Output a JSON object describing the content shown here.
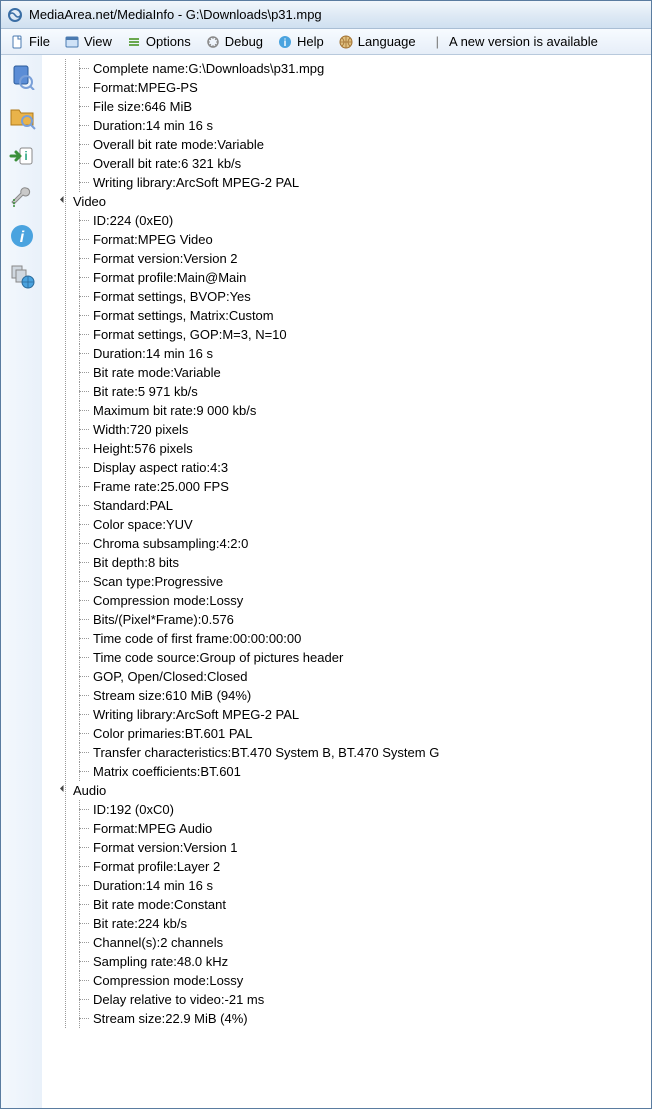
{
  "window": {
    "title": "MediaArea.net/MediaInfo - G:\\Downloads\\p31.mpg"
  },
  "menu": {
    "file": "File",
    "view": "View",
    "options": "Options",
    "debug": "Debug",
    "help": "Help",
    "language": "Language",
    "version_notice": "A new version is available"
  },
  "general": {
    "items": [
      {
        "label": "Complete name",
        "value": "G:\\Downloads\\p31.mpg"
      },
      {
        "label": "Format",
        "value": "MPEG-PS"
      },
      {
        "label": "File size",
        "value": "646 MiB"
      },
      {
        "label": "Duration",
        "value": "14 min 16 s"
      },
      {
        "label": "Overall bit rate mode",
        "value": "Variable"
      },
      {
        "label": "Overall bit rate",
        "value": "6 321 kb/s"
      },
      {
        "label": "Writing library",
        "value": "ArcSoft MPEG-2 PAL"
      }
    ]
  },
  "video": {
    "title": "Video",
    "items": [
      {
        "label": "ID",
        "value": "224 (0xE0)"
      },
      {
        "label": "Format",
        "value": "MPEG Video"
      },
      {
        "label": "Format version",
        "value": "Version 2"
      },
      {
        "label": "Format profile",
        "value": "Main@Main"
      },
      {
        "label": "Format settings, BVOP",
        "value": "Yes"
      },
      {
        "label": "Format settings, Matrix",
        "value": "Custom"
      },
      {
        "label": "Format settings, GOP",
        "value": "M=3, N=10"
      },
      {
        "label": "Duration",
        "value": "14 min 16 s"
      },
      {
        "label": "Bit rate mode",
        "value": "Variable"
      },
      {
        "label": "Bit rate",
        "value": "5 971 kb/s"
      },
      {
        "label": "Maximum bit rate",
        "value": "9 000 kb/s"
      },
      {
        "label": "Width",
        "value": "720 pixels"
      },
      {
        "label": "Height",
        "value": "576 pixels"
      },
      {
        "label": "Display aspect ratio",
        "value": "4:3"
      },
      {
        "label": "Frame rate",
        "value": "25.000 FPS"
      },
      {
        "label": "Standard",
        "value": "PAL"
      },
      {
        "label": "Color space",
        "value": "YUV"
      },
      {
        "label": "Chroma subsampling",
        "value": "4:2:0"
      },
      {
        "label": "Bit depth",
        "value": "8 bits"
      },
      {
        "label": "Scan type",
        "value": "Progressive"
      },
      {
        "label": "Compression mode",
        "value": "Lossy"
      },
      {
        "label": "Bits/(Pixel*Frame)",
        "value": "0.576"
      },
      {
        "label": "Time code of first frame",
        "value": "00:00:00:00"
      },
      {
        "label": "Time code source",
        "value": "Group of pictures header"
      },
      {
        "label": "GOP, Open/Closed",
        "value": "Closed"
      },
      {
        "label": "Stream size",
        "value": "610 MiB (94%)"
      },
      {
        "label": "Writing library",
        "value": "ArcSoft MPEG-2 PAL"
      },
      {
        "label": "Color primaries",
        "value": "BT.601 PAL"
      },
      {
        "label": "Transfer characteristics",
        "value": "BT.470 System B, BT.470 System G"
      },
      {
        "label": "Matrix coefficients",
        "value": "BT.601"
      }
    ]
  },
  "audio": {
    "title": "Audio",
    "items": [
      {
        "label": "ID",
        "value": "192 (0xC0)"
      },
      {
        "label": "Format",
        "value": "MPEG Audio"
      },
      {
        "label": "Format version",
        "value": "Version 1"
      },
      {
        "label": "Format profile",
        "value": "Layer 2"
      },
      {
        "label": "Duration",
        "value": "14 min 16 s"
      },
      {
        "label": "Bit rate mode",
        "value": "Constant"
      },
      {
        "label": "Bit rate",
        "value": "224 kb/s"
      },
      {
        "label": "Channel(s)",
        "value": "2 channels"
      },
      {
        "label": "Sampling rate",
        "value": "48.0 kHz"
      },
      {
        "label": "Compression mode",
        "value": "Lossy"
      },
      {
        "label": "Delay relative to video",
        "value": "-21 ms"
      },
      {
        "label": "Stream size",
        "value": "22.9 MiB (4%)"
      }
    ]
  }
}
